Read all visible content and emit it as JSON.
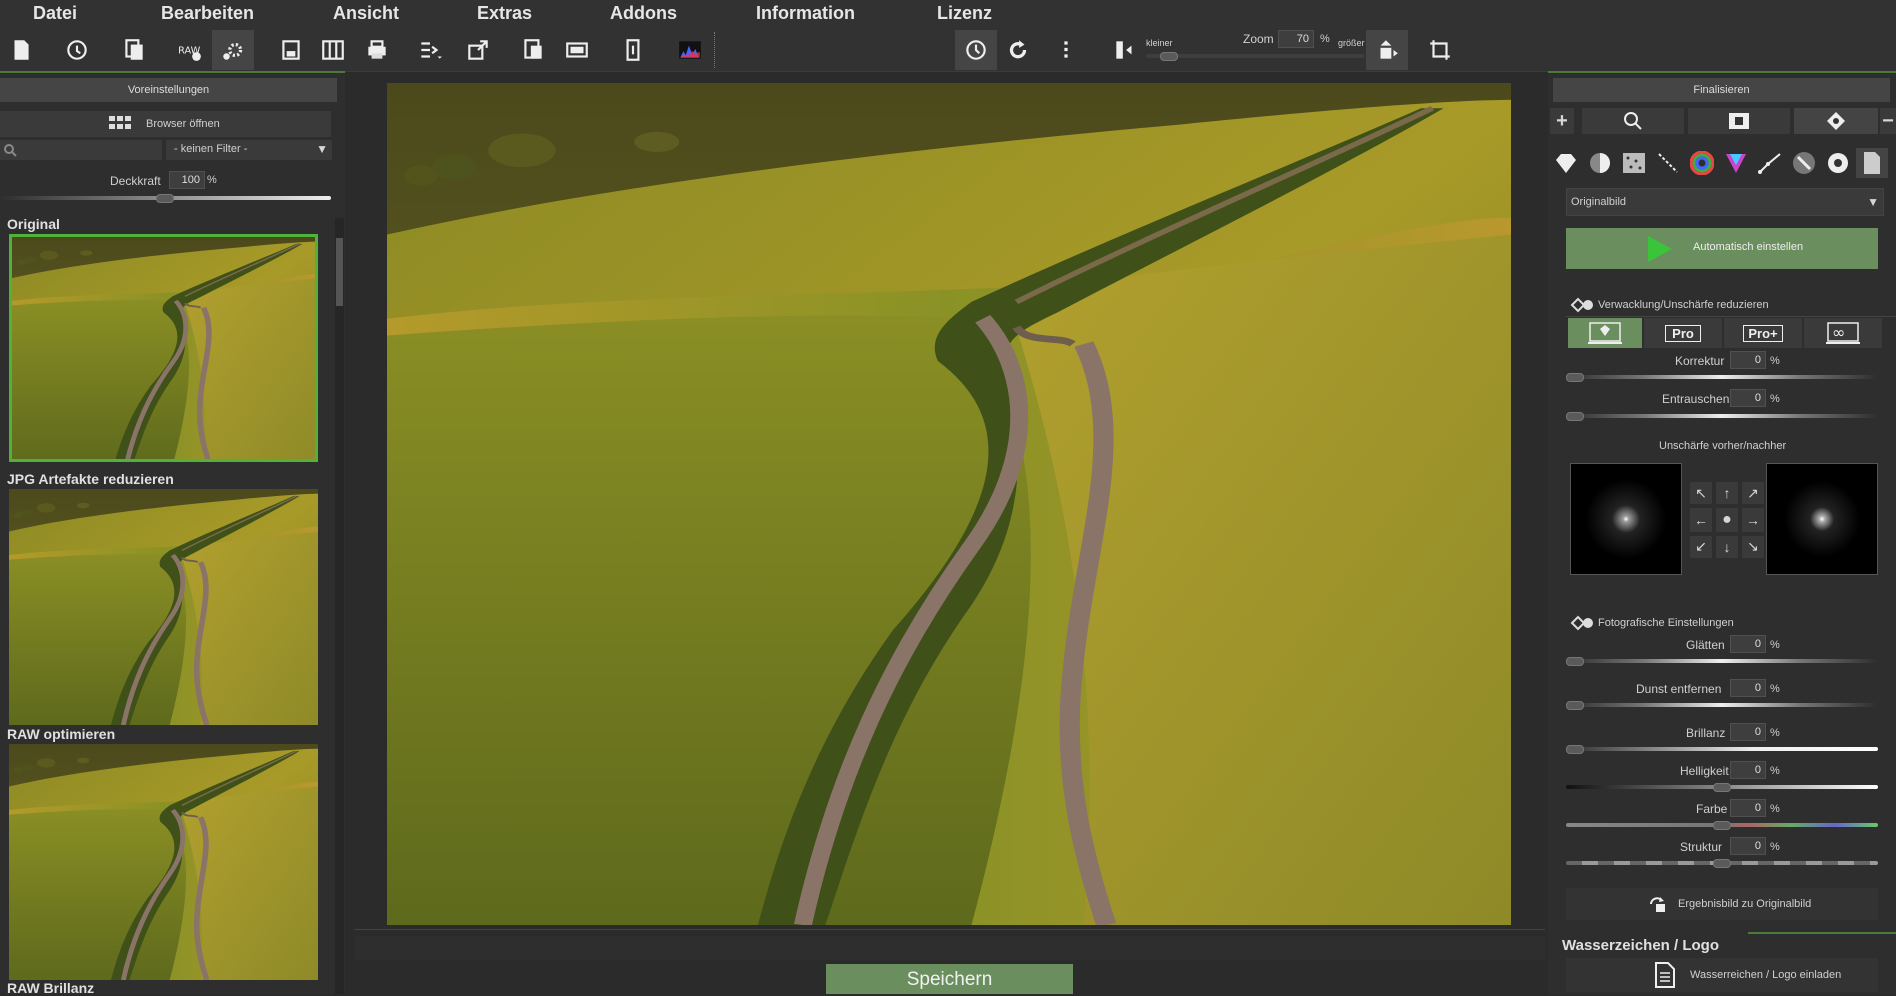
{
  "menu": {
    "items": [
      "Datei",
      "Bearbeiten",
      "Ansicht",
      "Extras",
      "Addons",
      "Information",
      "Lizenz"
    ]
  },
  "toolbar": {
    "zoom_label": "Zoom",
    "zoom_value": "70",
    "zoom_unit": "%",
    "smaller": "kleiner",
    "larger": "größer"
  },
  "left": {
    "header": "Voreinstellungen",
    "browser_button": "Browser öffnen",
    "filter_value": "- keinen Filter -",
    "opacity_label": "Deckkraft",
    "opacity_value": "100",
    "opacity_unit": "%",
    "presets": [
      {
        "title": "Original"
      },
      {
        "title": "JPG Artefakte reduzieren"
      },
      {
        "title": "RAW optimieren"
      },
      {
        "title": "RAW Brillanz"
      }
    ]
  },
  "right": {
    "header": "Finalisieren",
    "mode_select": "Originalbild",
    "auto_button": "Automatisch einstellen",
    "blur_section": "Verwacklung/Unschärfe reduzieren",
    "blur_modes": [
      "Pro",
      "Pro+"
    ],
    "korrektur_label": "Korrektur",
    "korrektur_value": "0",
    "entrauschen_label": "Entrauschen",
    "entrauschen_value": "0",
    "preview_label": "Unschärfe vorher/nachher",
    "photo_section": "Fotografische Einstellungen",
    "sliders": [
      {
        "label": "Glätten",
        "value": "0"
      },
      {
        "label": "Dunst entfernen",
        "value": "0"
      },
      {
        "label": "Brillanz",
        "value": "0"
      },
      {
        "label": "Helligkeit",
        "value": "0"
      },
      {
        "label": "Farbe",
        "value": "0"
      },
      {
        "label": "Struktur",
        "value": "0"
      }
    ],
    "unit": "%",
    "result_button": "Ergebnisbild zu Originalbild",
    "watermark_title": "Wasserzeichen / Logo",
    "watermark_button": "Wasserreichen / Logo einladen"
  },
  "save_button": "Speichern"
}
